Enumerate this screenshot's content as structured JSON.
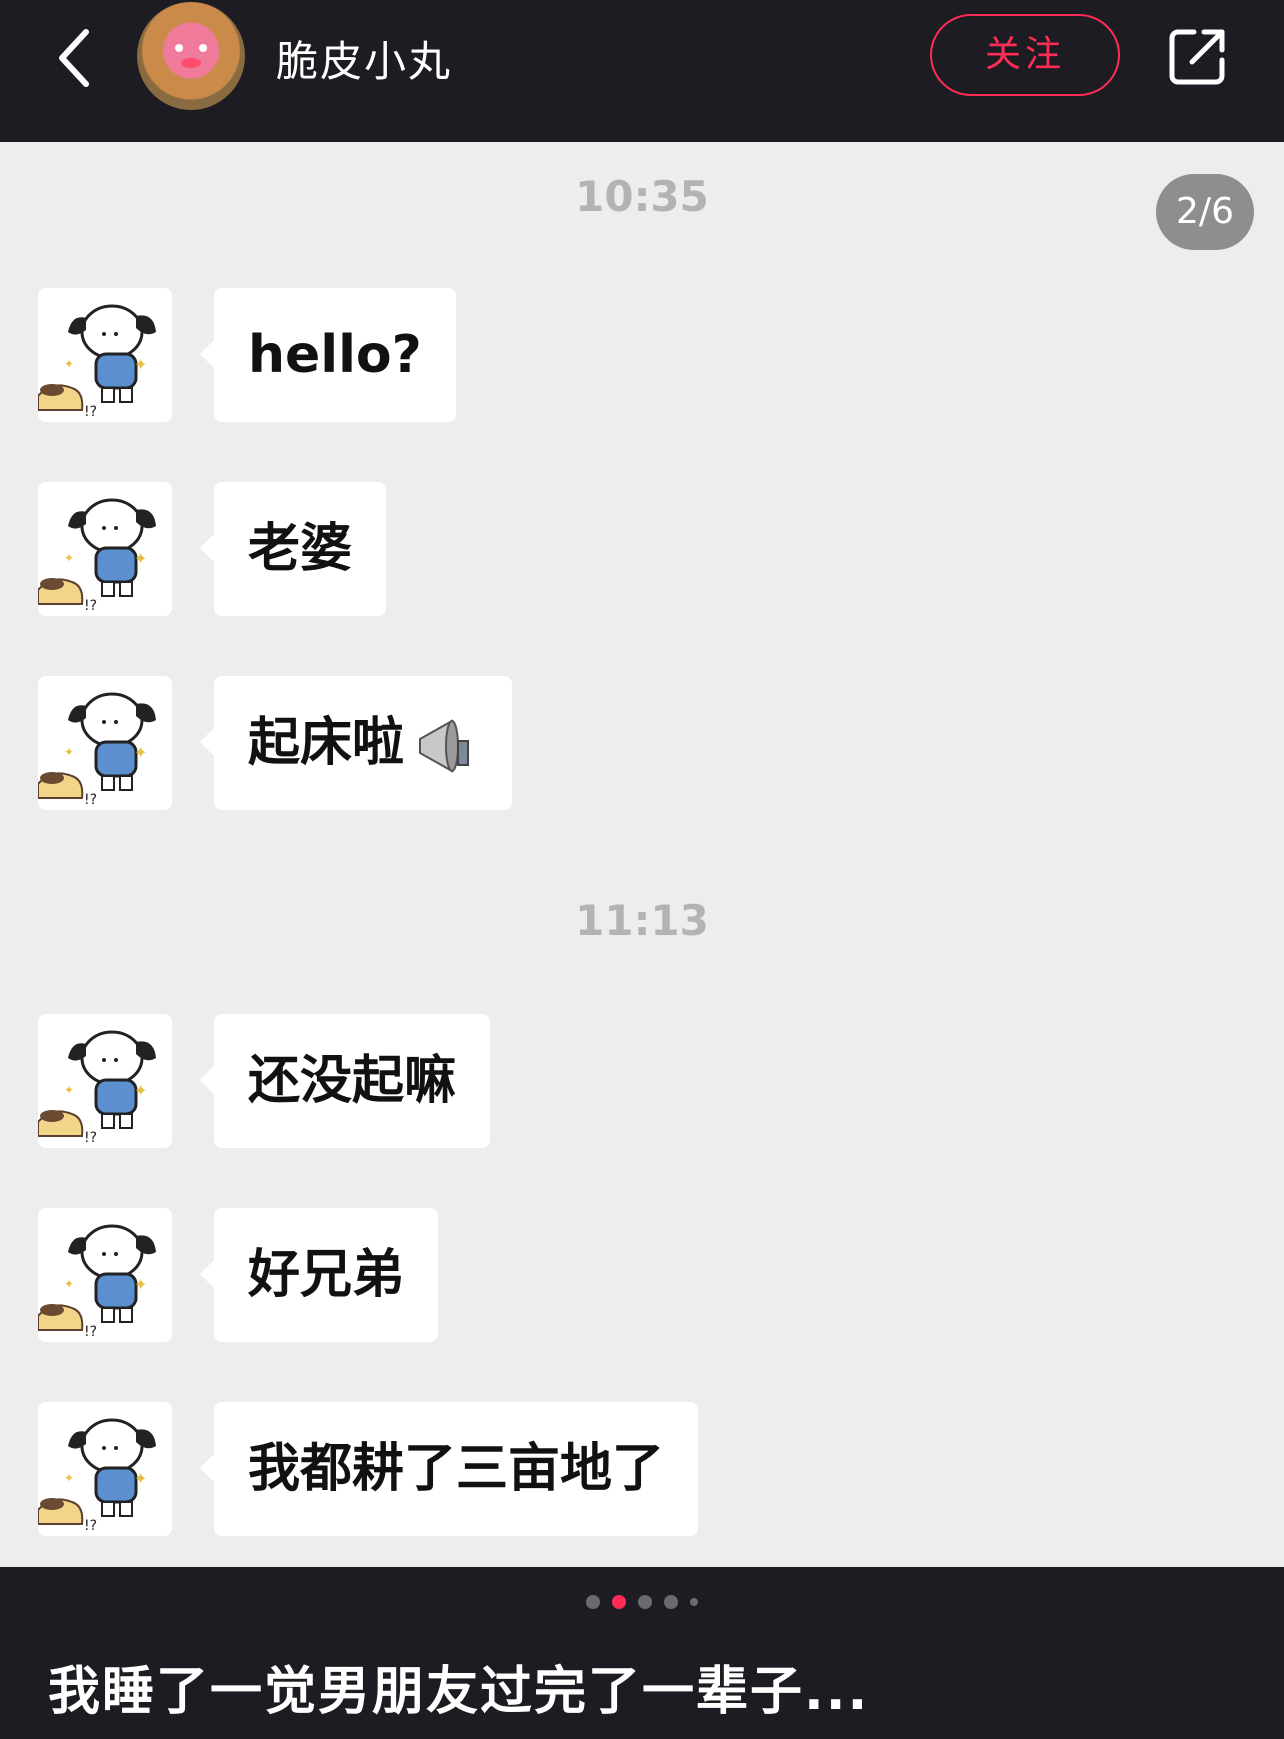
{
  "header": {
    "username": "脆皮小丸",
    "follow_label": "关注"
  },
  "chat": {
    "page_indicator": "2/6",
    "timestamps": [
      "10:35",
      "11:13"
    ],
    "messages": [
      {
        "text": "hello?"
      },
      {
        "text": "老婆"
      },
      {
        "text": "起床啦",
        "emoji": "megaphone-icon"
      },
      {
        "text": "还没起嘛"
      },
      {
        "text": "好兄弟"
      },
      {
        "text": "我都耕了三亩地了"
      }
    ]
  },
  "footer": {
    "carousel_dots": 5,
    "active_dot": 2,
    "caption": "我睡了一觉男朋友过完了一辈子..."
  },
  "colors": {
    "accent": "#ff2d55",
    "bar_bg": "#1c1c22",
    "chat_bg": "#ededed"
  }
}
